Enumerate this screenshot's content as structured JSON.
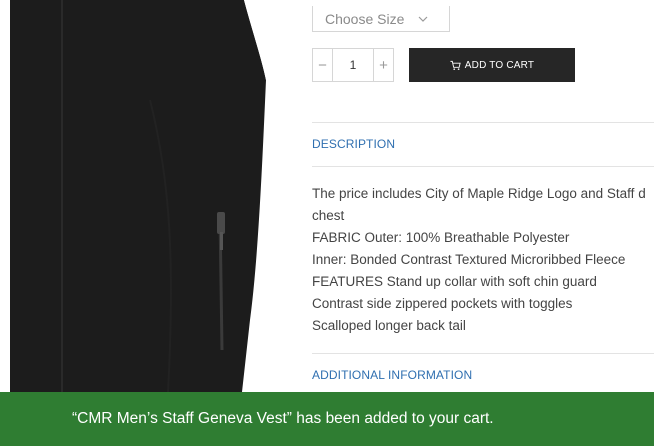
{
  "size_select": {
    "selected": "Choose Size"
  },
  "quantity": {
    "value": "1",
    "minus": "−",
    "plus": "+"
  },
  "add_to_cart": {
    "label": "ADD TO CART"
  },
  "tabs": {
    "description": "DESCRIPTION",
    "additional": "ADDITIONAL INFORMATION"
  },
  "description_lines": [
    "The price includes City of Maple Ridge Logo and Staff d",
    "chest",
    "FABRIC Outer: 100% Breathable Polyester",
    "Inner: Bonded Contrast Textured Microribbed Fleece",
    "FEATURES Stand up collar with soft chin guard",
    "Contrast side zippered pockets with toggles",
    "Scalloped longer back tail"
  ],
  "notice": {
    "text": "“CMR Men’s Staff Geneva Vest” has been added to your cart."
  },
  "colors": {
    "notice_bg": "#2f7d32",
    "button_bg": "#262626",
    "link": "#2f6fb0"
  },
  "icons": {
    "cart": "cart-icon",
    "chevron": "chevron-down-icon"
  }
}
